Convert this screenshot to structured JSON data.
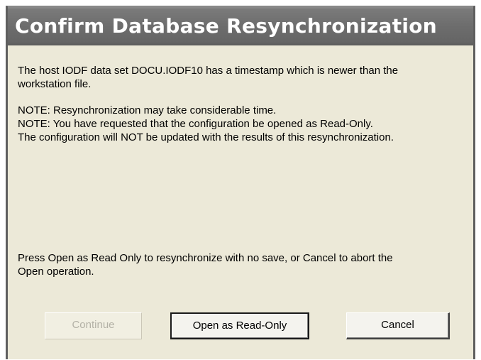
{
  "dialog": {
    "title": "Confirm Database Resynchronization",
    "message_paragraph_1": [
      "The host IODF data set DOCU.IODF10 has a timestamp which is newer than the",
      "workstation file."
    ],
    "message_paragraph_2": [
      "NOTE: Resynchronization may take considerable time.",
      "NOTE: You have requested that the configuration be opened as Read-Only.",
      "The configuration will NOT be updated with the results of this resynchronization."
    ],
    "message_paragraph_3": [
      "Press Open as Read Only to resynchronize with no save, or Cancel to abort the",
      "Open operation."
    ],
    "buttons": {
      "continue_label": "Continue",
      "continue_enabled": false,
      "open_readonly_label": "Open as Read-Only",
      "cancel_label": "Cancel"
    }
  },
  "colors": {
    "title_bar": "#6d6d6d",
    "title_text": "#ffffff",
    "dialog_background": "#ece9d8",
    "disabled_text": "#b3b1a6"
  }
}
